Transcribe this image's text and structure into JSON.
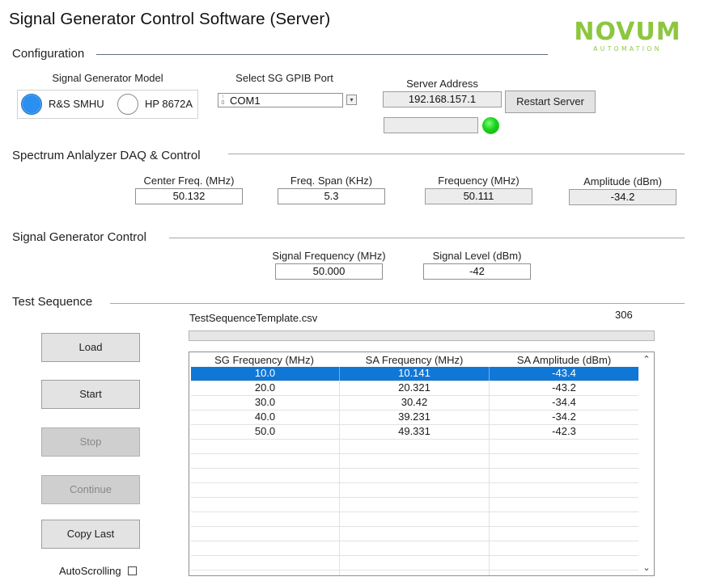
{
  "app": {
    "title": "Signal Generator Control Software (Server)"
  },
  "logo": {
    "main": "NOVUM",
    "sub": "AUTOMATION",
    "color": "#8dc63f"
  },
  "configuration": {
    "title": "Configuration",
    "model": {
      "label": "Signal Generator Model",
      "options": [
        {
          "label": "R&S SMHU",
          "selected": true
        },
        {
          "label": "HP 8672A",
          "selected": false
        }
      ]
    },
    "gpib": {
      "label": "Select SG GPIB Port",
      "value": "COM1",
      "spin_up": "↑",
      "spin_down": "0",
      "arrow": "▾"
    },
    "server": {
      "label": "Server Address",
      "address": "192.168.157.1",
      "restart_label": "Restart Server",
      "status_text": "",
      "status_led_color": "#1fd41f"
    }
  },
  "spectrum": {
    "title": "Spectrum Anlalyzer DAQ & Control",
    "center_freq": {
      "label": "Center Freq. (MHz)",
      "value": "50.132"
    },
    "freq_span": {
      "label": "Freq. Span (KHz)",
      "value": "5.3"
    },
    "frequency": {
      "label": "Frequency (MHz)",
      "value": "50.111"
    },
    "amplitude": {
      "label": "Amplitude (dBm)",
      "value": "-34.2"
    }
  },
  "sg_control": {
    "title": "Signal Generator Control",
    "signal_frequency": {
      "label": "Signal Frequency (MHz)",
      "value": "50.000"
    },
    "signal_level": {
      "label": "Signal Level (dBm)",
      "value": "-42"
    }
  },
  "test_sequence": {
    "title": "Test Sequence",
    "file_name": "TestSequenceTemplate.csv",
    "counter": "306",
    "progress": 0,
    "buttons": {
      "load": "Load",
      "start": "Start",
      "stop": "Stop",
      "continue": "Continue",
      "copy_last": "Copy Last"
    },
    "autoscroll_label": "AutoScrolling",
    "autoscroll_checked": false,
    "table": {
      "columns": [
        "SG Frequency (MHz)",
        "SA Frequency (MHz)",
        "SA Amplitude (dBm)"
      ],
      "rows": [
        [
          "10.0",
          "10.141",
          "-43.4"
        ],
        [
          "20.0",
          "20.321",
          "-43.2"
        ],
        [
          "30.0",
          "30.42",
          "-34.4"
        ],
        [
          "40.0",
          "39.231",
          "-34.2"
        ],
        [
          "50.0",
          "49.331",
          "-42.3"
        ]
      ],
      "selected_row": 0,
      "total_visible_rows": 15,
      "scroll_up": "⌃",
      "scroll_down": "⌄"
    }
  }
}
